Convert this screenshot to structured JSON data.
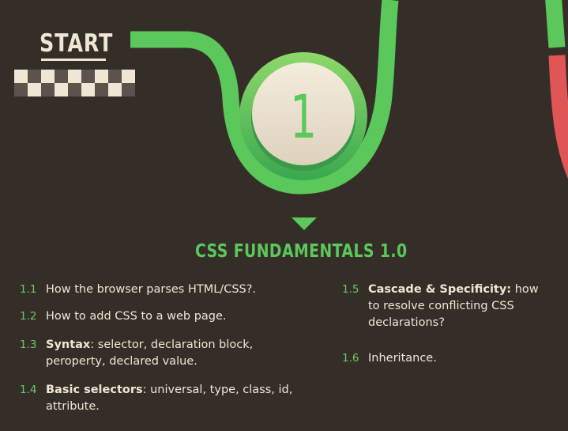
{
  "start_label": "START",
  "badge_number": "1",
  "section_title": "CSS FUNDAMENTALS 1.0",
  "colors": {
    "background": "#352e28",
    "track_green": "#5ac85a",
    "track_red": "#e05555",
    "badge_inner": "#efe6d4",
    "text": "#efe6d4",
    "flag_light": "#efe6d4",
    "flag_dark": "#5b534c"
  },
  "items": [
    {
      "num": "1.1",
      "bold": "",
      "lines": [
        "How the browser parses HTML/CSS?."
      ]
    },
    {
      "num": "1.2",
      "bold": "",
      "lines": [
        "How to add CSS to a web page."
      ]
    },
    {
      "num": "1.3",
      "bold": "Syntax",
      "lines": [
        ": selector, declaration block,",
        "peroperty, declared value."
      ]
    },
    {
      "num": "1.4",
      "bold": "Basic selectors",
      "lines": [
        ": universal, type, class, id,",
        "attribute."
      ]
    },
    {
      "num": "1.5",
      "bold": "Cascade & Specificity:",
      "lines": [
        " how",
        "to resolve conflicting CSS",
        "declarations?"
      ]
    },
    {
      "num": "1.6",
      "bold": "",
      "lines": [
        "Inheritance."
      ]
    }
  ]
}
